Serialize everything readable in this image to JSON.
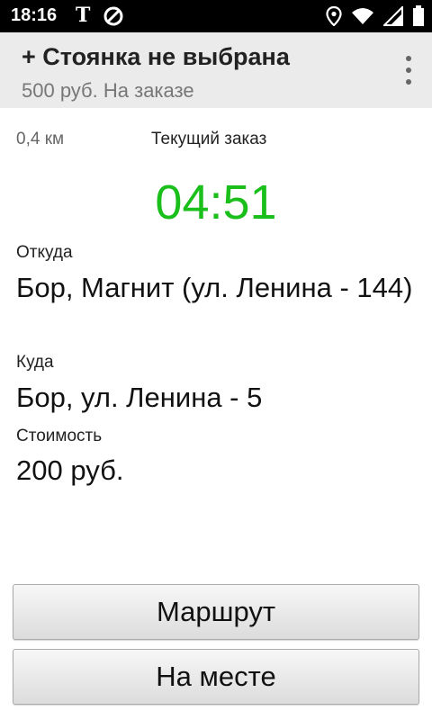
{
  "status_bar": {
    "time": "18:16",
    "app_icon_letter": "T",
    "icons": [
      "t-letter-icon",
      "blocked-circle-icon",
      "location-icon",
      "wifi-icon",
      "signal-icon",
      "battery-icon"
    ]
  },
  "app_bar": {
    "title": "+ Стоянка не выбрана",
    "subtitle": "500 руб. На заказе",
    "menu_icon": "more-vert-icon",
    "background": "#ebebeb"
  },
  "order": {
    "distance": "0,4 км",
    "header": "Текущий заказ",
    "timer": "04:51",
    "timer_color": "#1bbf1b",
    "from_label": "Откуда",
    "from_value": "Бор, Магнит (ул. Ленина - 144)",
    "to_label": "Куда",
    "to_value": "Бор, ул. Ленина - 5",
    "cost_label": "Стоимость",
    "cost_value": "200 руб."
  },
  "buttons": {
    "route": "Маршрут",
    "arrived": "На месте"
  }
}
